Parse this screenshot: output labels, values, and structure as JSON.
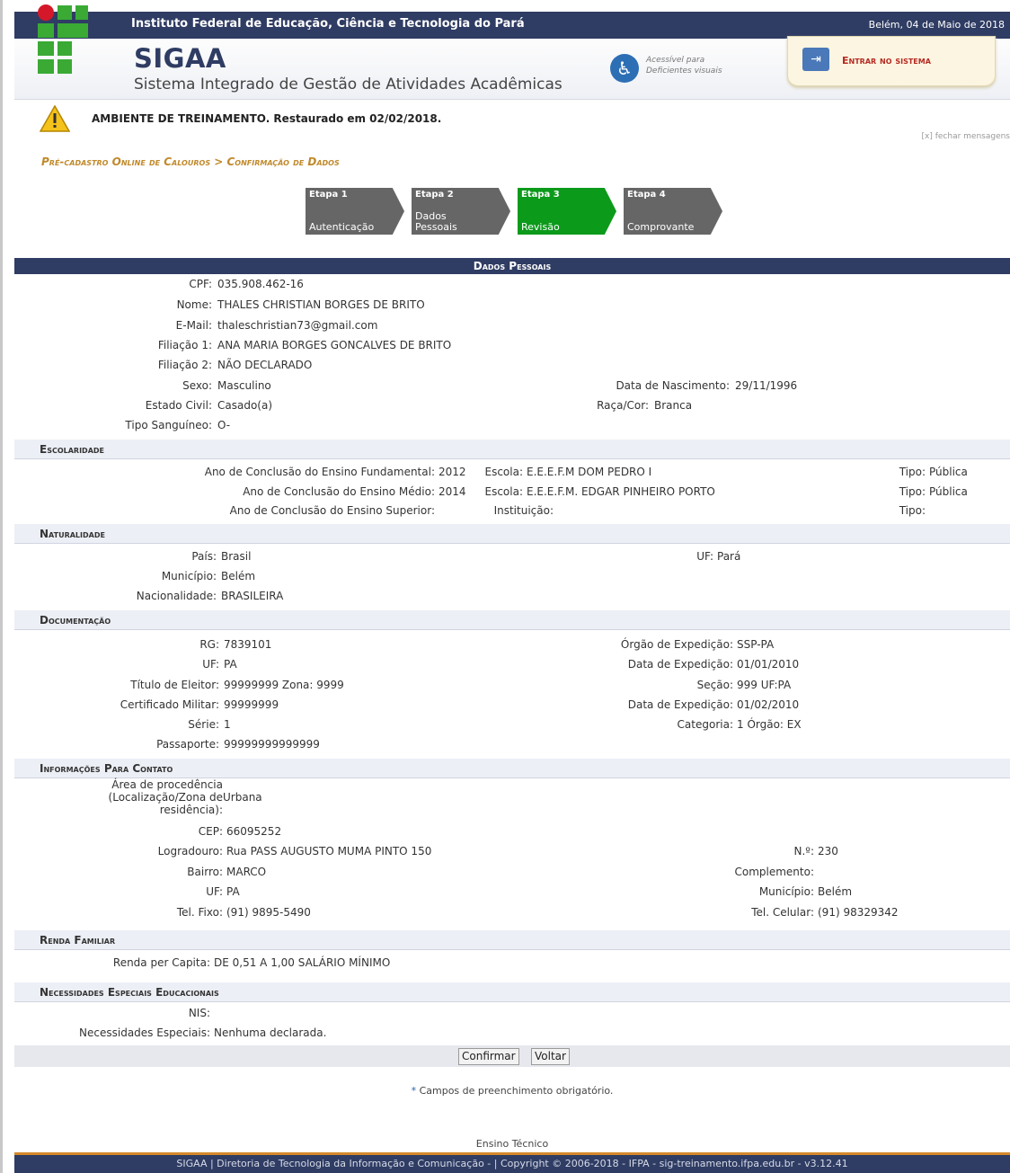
{
  "header": {
    "institution": "Instituto Federal de Educação, Ciência e Tecnologia do Pará",
    "date": "Belém, 04 de Maio de 2018",
    "app_name": "SIGAA",
    "app_subtitle": "Sistema Integrado de Gestão de Atividades Acadêmicas",
    "accessibility_line1": "Acessível para",
    "accessibility_line2": "Deficientes visuais",
    "enter_label": "Entrar no sistema"
  },
  "warning": {
    "text": "AMBIENTE DE TREINAMENTO. Restaurado em 02/02/2018.",
    "close": "[x] fechar mensagens"
  },
  "breadcrumb": "Pré-cadastro Online de Calouros > Confirmação de Dados",
  "steps": [
    {
      "label": "Etapa 1",
      "name": "Autenticação"
    },
    {
      "label": "Etapa 2",
      "name": "Dados Pessoais"
    },
    {
      "label": "Etapa 3",
      "name": "Revisão"
    },
    {
      "label": "Etapa 4",
      "name": "Comprovante"
    }
  ],
  "dados_pessoais": {
    "title": "Dados Pessoais",
    "cpf_label": "CPF:",
    "cpf": "035.908.462-16",
    "nome_label": "Nome:",
    "nome": "THALES CHRISTIAN BORGES DE BRITO",
    "email_label": "E-Mail:",
    "email": "thaleschristian73@gmail.com",
    "filiacao1_label": "Filiação 1:",
    "filiacao1": "ANA MARIA BORGES GONCALVES DE BRITO",
    "filiacao2_label": "Filiação 2:",
    "filiacao2": "NÃO DECLARADO",
    "sexo_label": "Sexo:",
    "sexo": "Masculino",
    "nascimento_label": "Data de Nascimento:",
    "nascimento": "29/11/1996",
    "estado_civil_label": "Estado Civil:",
    "estado_civil": "Casado(a)",
    "raca_label": "Raça/Cor:",
    "raca": "Branca",
    "sangue_label": "Tipo Sanguíneo:",
    "sangue": "O-"
  },
  "escolaridade": {
    "title": "Escolaridade",
    "fund_label": "Ano de Conclusão do Ensino Fundamental:",
    "fund": "2012",
    "fund_escola_label": "Escola:",
    "fund_escola": "E.E.E.F.M DOM PEDRO I",
    "fund_tipo_label": "Tipo:",
    "fund_tipo": "Pública",
    "medio_label": "Ano de Conclusão do Ensino Médio:",
    "medio": "2014",
    "medio_escola_label": "Escola:",
    "medio_escola": "E.E.E.F.M. EDGAR PINHEIRO PORTO",
    "medio_tipo_label": "Tipo:",
    "medio_tipo": "Pública",
    "sup_label": "Ano de Conclusão do Ensino Superior:",
    "sup_inst_label": "Instituição:",
    "sup_tipo_label": "Tipo:"
  },
  "naturalidade": {
    "title": "Naturalidade",
    "pais_label": "País:",
    "pais": "Brasil",
    "uf_label": "UF:",
    "uf": "Pará",
    "municipio_label": "Município:",
    "municipio": "Belém",
    "nac_label": "Nacionalidade:",
    "nac": "BRASILEIRA"
  },
  "documentacao": {
    "title": "Documentação",
    "rg_label": "RG:",
    "rg": "7839101",
    "orgao_label": "Órgão de Expedição:",
    "orgao": "SSP-PA",
    "uf_label": "UF:",
    "uf": "PA",
    "data_exp_label": "Data de Expedição:",
    "data_exp": "01/01/2010",
    "titulo_label": "Título de Eleitor:",
    "titulo": "99999999 Zona: 9999",
    "secao_label": "Seção:",
    "secao": "999 UF:PA",
    "cert_label": "Certificado Militar:",
    "cert": "99999999",
    "data_exp2_label": "Data de Expedição:",
    "data_exp2": "01/02/2010",
    "serie_label": "Série:",
    "serie": "1",
    "categoria_label": "Categoria:",
    "categoria": "1 Órgão: EX",
    "passaporte_label": "Passaporte:",
    "passaporte": "99999999999999"
  },
  "contato": {
    "title": "Informações Para Contato",
    "area_label_1": "Área de procedência",
    "area_label_2": "(Localização/Zona de",
    "area_label_3": "residência):",
    "area": "Urbana",
    "cep_label": "CEP:",
    "cep": "66095252",
    "logradouro_label": "Logradouro:",
    "logradouro": "Rua PASS AUGUSTO MUMA PINTO 150",
    "numero_label": "N.º:",
    "numero": "230",
    "bairro_label": "Bairro:",
    "bairro": "MARCO",
    "complemento_label": "Complemento:",
    "uf_label": "UF:",
    "uf": "PA",
    "municipio_label": "Município:",
    "municipio": "Belém",
    "fixo_label": "Tel. Fixo:",
    "fixo": "(91) 9895-5490",
    "celular_label": "Tel. Celular:",
    "celular": "(91) 98329342"
  },
  "renda": {
    "title": "Renda Familiar",
    "label": "Renda per Capita:",
    "value": "DE 0,51 A 1,00 SALÁRIO MÍNIMO"
  },
  "necessidades": {
    "title": "Necessidades Especiais Educacionais",
    "nis_label": "NIS:",
    "nec_label": "Necessidades Especiais:",
    "nec": "Nenhuma declarada."
  },
  "buttons": {
    "confirm": "Confirmar",
    "back": "Voltar"
  },
  "note": "Campos de preenchimento obrigatório.",
  "note_star": "*",
  "ensino": "Ensino Técnico",
  "footer": "SIGAA | Diretoria de Tecnologia da Informação e Comunicação - | Copyright © 2006-2018 - IFPA - sig-treinamento.ifpa.edu.br - v3.12.41",
  "colors": {
    "header_blue": "#2f3c63",
    "step_green": "#0c9a1b",
    "step_gray": "#666666",
    "enter_red": "#b52a22"
  }
}
